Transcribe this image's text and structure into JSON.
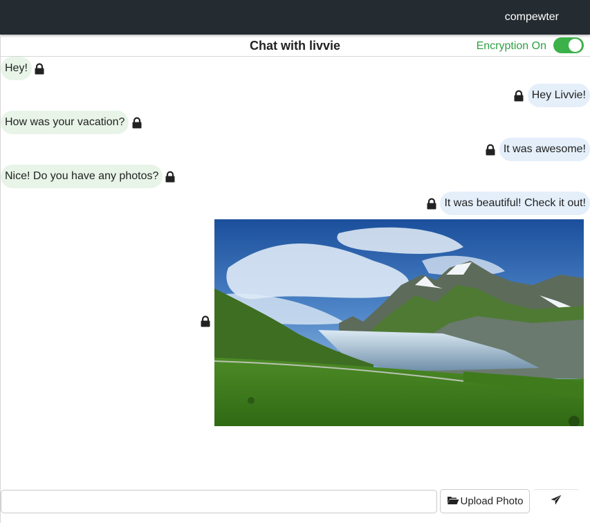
{
  "header": {
    "username": "compewter"
  },
  "chat": {
    "title": "Chat with livvie",
    "encryption_label": "Encryption On",
    "encryption_enabled": true,
    "messages": [
      {
        "text": "Hey!",
        "direction": "incoming"
      },
      {
        "text": "Hey Livvie!",
        "direction": "outgoing"
      },
      {
        "text": "How was your vacation?",
        "direction": "incoming"
      },
      {
        "text": "It was awesome!",
        "direction": "outgoing"
      },
      {
        "text": "Nice! Do you have any photos?",
        "direction": "incoming"
      },
      {
        "text": "It was beautiful! Check it out!",
        "direction": "outgoing"
      }
    ],
    "photo": {
      "direction": "outgoing",
      "subject": "mountain lake landscape"
    }
  },
  "composer": {
    "input_value": "",
    "input_placeholder": "",
    "upload_label": "Upload Photo",
    "upload_icon": "folder-open-icon",
    "send_icon": "paper-plane-icon"
  },
  "colors": {
    "topbar": "#242b31",
    "incoming_bubble": "#e8f4e8",
    "outgoing_bubble": "#e4effa",
    "encryption_green": "#2ea043",
    "toggle_on": "#3cb14a"
  }
}
